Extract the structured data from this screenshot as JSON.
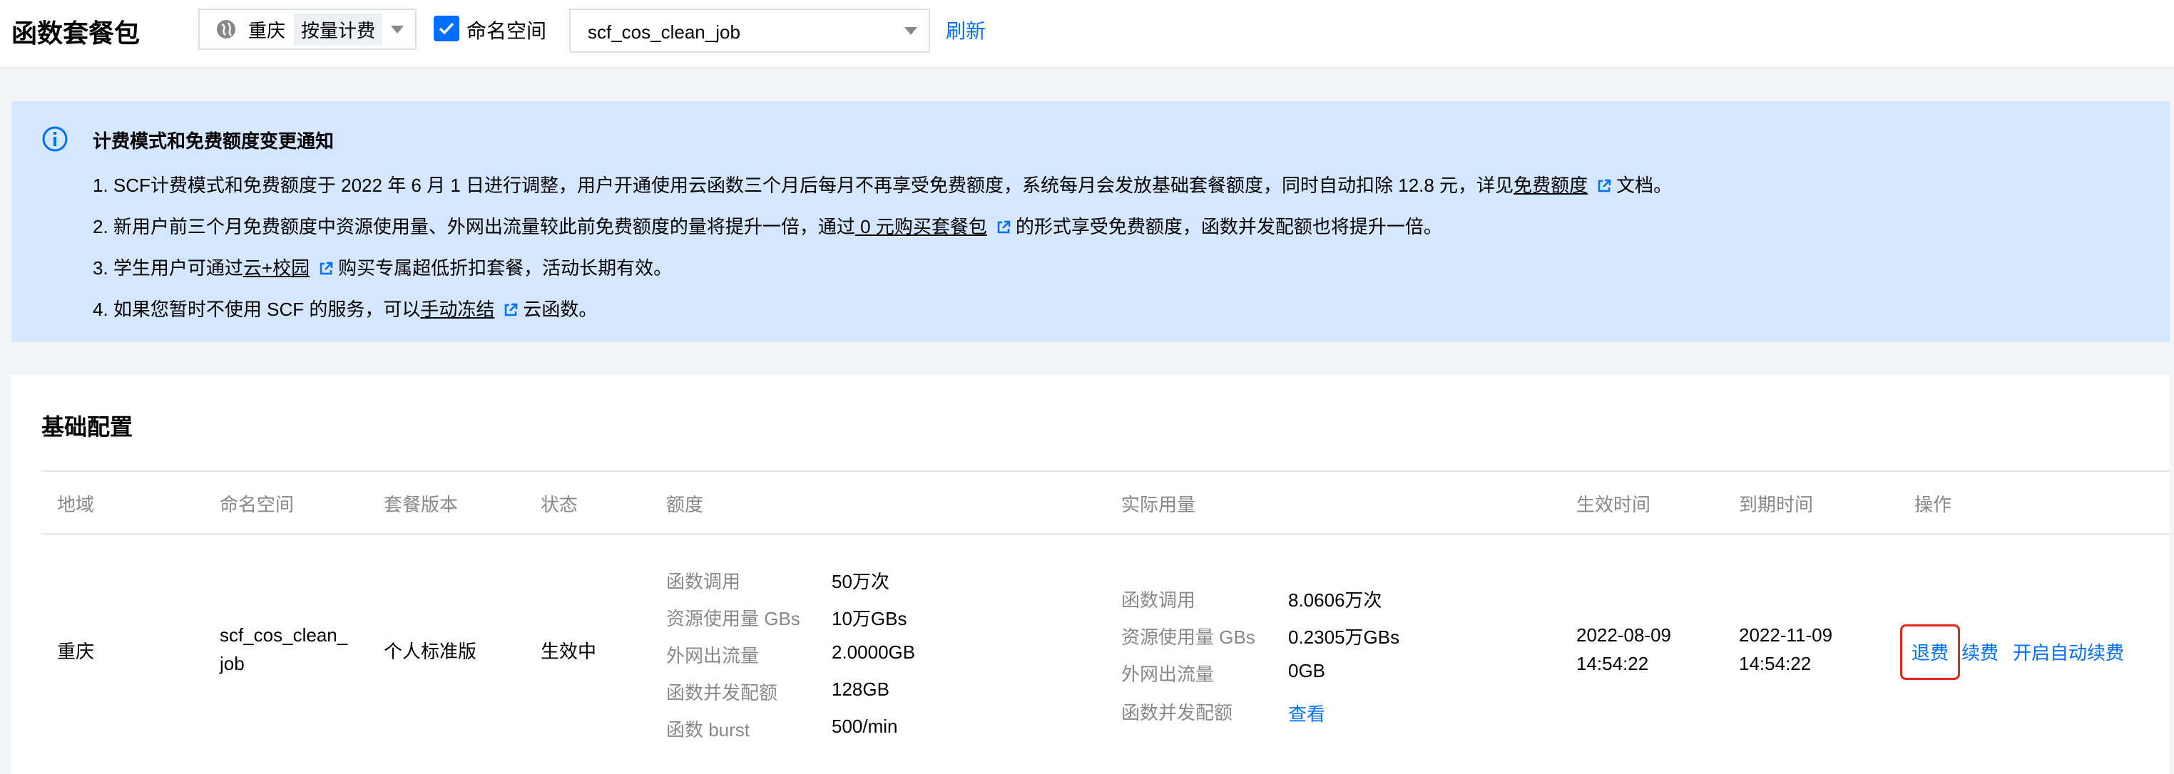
{
  "header": {
    "title": "函数套餐包",
    "region": "重庆",
    "billing_mode": "按量计费",
    "namespace_label": "命名空间",
    "namespace_value": "scf_cos_clean_job",
    "refresh": "刷新"
  },
  "notice": {
    "title": "计费模式和免费额度变更通知",
    "line1_prefix": "1. SCF计费模式和免费额度于 2022 年 6 月 1 日进行调整，用户开通使用云函数三个月后每月不再享受免费额度，系统每月会发放基础套餐额度，同时自动扣除 12.8 元，详见",
    "line1_link": "免费额度",
    "line1_suffix": "文档。",
    "line2_prefix": "2. 新用户前三个月免费额度中资源使用量、外网出流量较此前免费额度的量将提升一倍，通过",
    "line2_link": " 0 元购买套餐包",
    "line2_suffix": "的形式享受免费额度，函数并发配额也将提升一倍。",
    "line3_prefix": "3. 学生用户可通过",
    "line3_link": "云+校园",
    "line3_suffix": "购买专属超低折扣套餐，活动长期有效。",
    "line4_prefix": "4. 如果您暂时不使用 SCF 的服务，可以",
    "line4_link": "手动冻结",
    "line4_suffix": "云函数。"
  },
  "card": {
    "title": "基础配置",
    "columns": [
      "地域",
      "命名空间",
      "套餐版本",
      "状态",
      "额度",
      "实际用量",
      "生效时间",
      "到期时间",
      "操作"
    ],
    "row": {
      "region": "重庆",
      "namespace_l1": "scf_cos_clean_",
      "namespace_l2": "job",
      "version": "个人标准版",
      "status": "生效中",
      "quota": [
        {
          "label": "函数调用",
          "value": "50万次"
        },
        {
          "label": "资源使用量 GBs",
          "value": "10万GBs"
        },
        {
          "label": "外网出流量",
          "value": "2.0000GB"
        },
        {
          "label": "函数并发配额",
          "value": "128GB"
        },
        {
          "label": "函数 burst",
          "value": "500/min"
        }
      ],
      "usage": [
        {
          "label": "函数调用",
          "value": "8.0606万次"
        },
        {
          "label": "资源使用量 GBs",
          "value": "0.2305万GBs"
        },
        {
          "label": "外网出流量",
          "value": "0GB"
        },
        {
          "label": "函数并发配额",
          "value": "查看"
        }
      ],
      "start_date": "2022-08-09",
      "start_time": "14:54:22",
      "end_date": "2022-11-09",
      "end_time": "14:54:22",
      "actions": [
        "退费",
        "续费",
        "开启自动续费"
      ]
    }
  }
}
